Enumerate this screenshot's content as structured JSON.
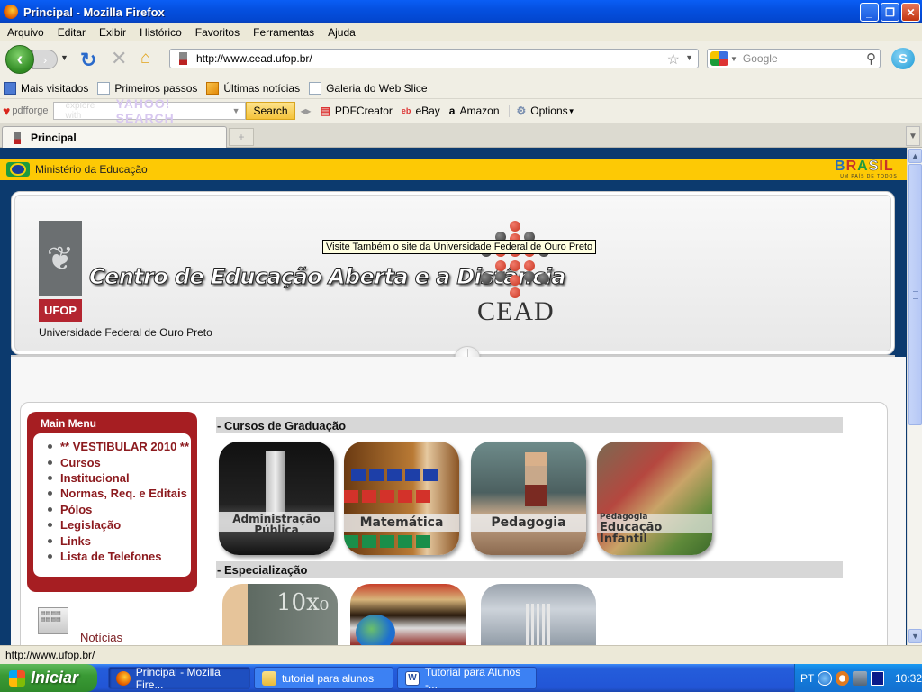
{
  "window": {
    "title": "Principal - Mozilla Firefox",
    "controls": {
      "minimize": "_",
      "restore": "❐",
      "close": "✕"
    }
  },
  "menubar": [
    "Arquivo",
    "Editar",
    "Exibir",
    "Histórico",
    "Favoritos",
    "Ferramentas",
    "Ajuda"
  ],
  "navbar": {
    "back_icon": "‹",
    "forward_icon": "›",
    "reload_icon": "↻",
    "stop_icon": "✕",
    "home_icon": "⌂",
    "url": "http://www.cead.ufop.br/",
    "star_icon": "☆",
    "search_placeholder": "Google",
    "search_engine": "Google",
    "magnifier_icon": "⚲",
    "skype_icon": "S"
  },
  "bookmarks": [
    {
      "label": "Mais visitados",
      "icon": "most-visited-icon"
    },
    {
      "label": "Primeiros passos",
      "icon": "page-icon"
    },
    {
      "label": "Últimas notícias",
      "icon": "rss-icon"
    },
    {
      "label": "Galeria do Web Slice",
      "icon": "page-icon"
    }
  ],
  "pdfforge_toolbar": {
    "brand": "pdfforge",
    "search_placeholder_prefix": "explore with",
    "search_placeholder_brand": "YAHOO! SEARCH",
    "search_button": "Search",
    "items": [
      "PDFCreator",
      "eBay",
      "Amazon",
      "Options"
    ]
  },
  "tabs": [
    {
      "label": "Principal",
      "active": true
    }
  ],
  "newtab_icon": "+",
  "page": {
    "gov_bar": {
      "label": "Ministério da Educação",
      "brasil_word": "BRASIL",
      "brasil_slogan": "UM PAÍS DE TODOS"
    },
    "header": {
      "ufop_abbrev": "UFOP",
      "university": "Universidade Federal de Ouro Preto",
      "title": "Centro de Educação Aberta e a Distância",
      "logo_text": "CEAD",
      "tooltip": "Visite Também o site da Universidade Federal de Ouro Preto"
    },
    "main_menu": {
      "title": "Main Menu",
      "items": [
        "** VESTIBULAR 2010 **",
        "Cursos",
        "Institucional",
        "Normas, Req. e Editais",
        "Pólos",
        "Legislação",
        "Links",
        "Lista de Telefones"
      ]
    },
    "news_link": "Notícias",
    "sections": [
      {
        "title": "- Cursos de Graduação",
        "courses": [
          {
            "caption": "Administração Pública"
          },
          {
            "caption": "Matemática"
          },
          {
            "caption": "Pedagogia"
          },
          {
            "caption_small": "Pedagogia",
            "caption": "Educação Infantil"
          }
        ]
      },
      {
        "title": "- Especialização",
        "courses": [
          {
            "caption": ""
          },
          {
            "caption": ""
          },
          {
            "caption": ""
          }
        ]
      }
    ]
  },
  "statusbar": {
    "text": "http://www.ufop.br/"
  },
  "taskbar": {
    "start_label": "Iniciar",
    "tasks": [
      {
        "label": "Principal - Mozilla Fire...",
        "active": true
      },
      {
        "label": "tutorial para alunos",
        "active": false
      },
      {
        "label": "Tutorial para Alunos -...",
        "active": false
      }
    ],
    "tray": {
      "language": "PT",
      "clock": "10:32"
    }
  },
  "colors": {
    "menu_red": "#a61e22",
    "gov_yellow": "#fdc905",
    "page_navy": "#0c3a6e",
    "link_red": "#8c1a1e"
  }
}
